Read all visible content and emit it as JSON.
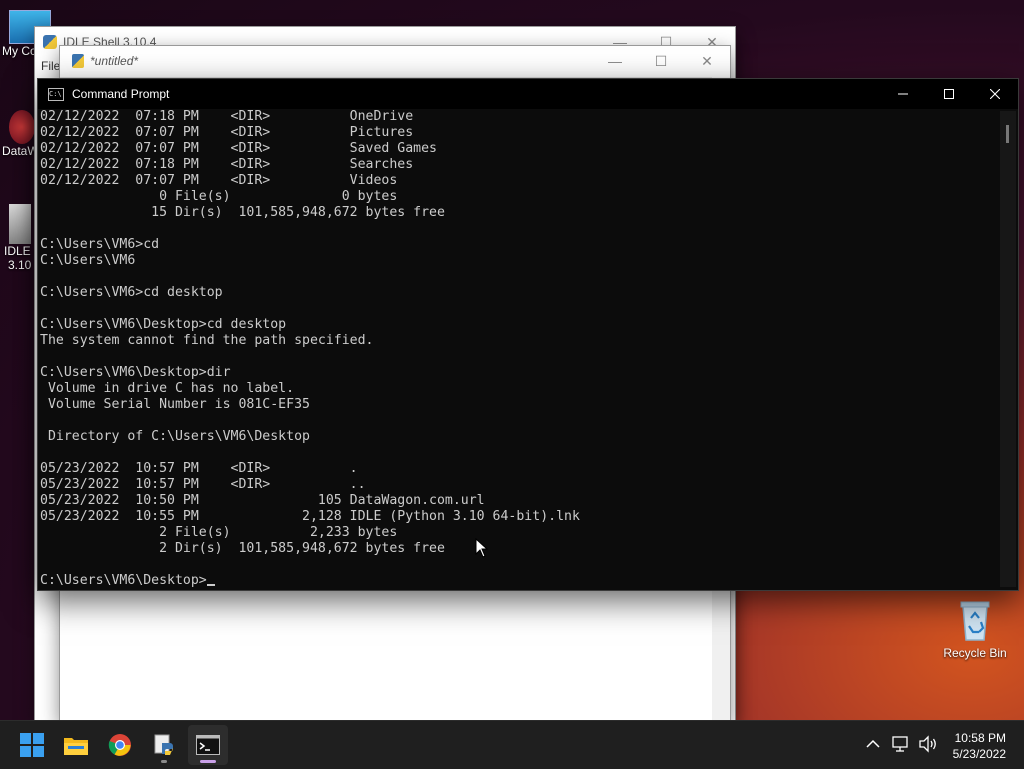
{
  "desktop": {
    "icons": [
      {
        "label": "My Co"
      },
      {
        "label": "DataW"
      },
      {
        "label": "IDLE (",
        "label2": "3.10"
      },
      {
        "label": "Recycle Bin"
      }
    ]
  },
  "idle_shell": {
    "title": "IDLE Shell 3.10.4",
    "menu_file": "File"
  },
  "untitled": {
    "title": "*untitled*"
  },
  "cmd": {
    "title": "Command Prompt",
    "lines": [
      "02/12/2022  07:18 PM    <DIR>          OneDrive",
      "02/12/2022  07:07 PM    <DIR>          Pictures",
      "02/12/2022  07:07 PM    <DIR>          Saved Games",
      "02/12/2022  07:18 PM    <DIR>          Searches",
      "02/12/2022  07:07 PM    <DIR>          Videos",
      "               0 File(s)              0 bytes",
      "              15 Dir(s)  101,585,948,672 bytes free",
      "",
      "C:\\Users\\VM6>cd",
      "C:\\Users\\VM6",
      "",
      "C:\\Users\\VM6>cd desktop",
      "",
      "C:\\Users\\VM6\\Desktop>cd desktop",
      "The system cannot find the path specified.",
      "",
      "C:\\Users\\VM6\\Desktop>dir",
      " Volume in drive C has no label.",
      " Volume Serial Number is 081C-EF35",
      "",
      " Directory of C:\\Users\\VM6\\Desktop",
      "",
      "05/23/2022  10:57 PM    <DIR>          .",
      "05/23/2022  10:57 PM    <DIR>          ..",
      "05/23/2022  10:50 PM               105 DataWagon.com.url",
      "05/23/2022  10:55 PM             2,128 IDLE (Python 3.10 64-bit).lnk",
      "               2 File(s)          2,233 bytes",
      "               2 Dir(s)  101,585,948,672 bytes free",
      ""
    ],
    "prompt": "C:\\Users\\VM6\\Desktop>"
  },
  "taskbar": {
    "apps": [
      {
        "name": "start-button"
      },
      {
        "name": "file-explorer"
      },
      {
        "name": "chrome"
      },
      {
        "name": "idle-python"
      },
      {
        "name": "command-prompt",
        "active": true
      }
    ],
    "time": "10:58 PM",
    "date": "5/23/2022"
  },
  "colors": {
    "accent_indicator": "#c9a0e8",
    "console_text": "#cccccc",
    "console_bg": "#0c0c0c"
  }
}
